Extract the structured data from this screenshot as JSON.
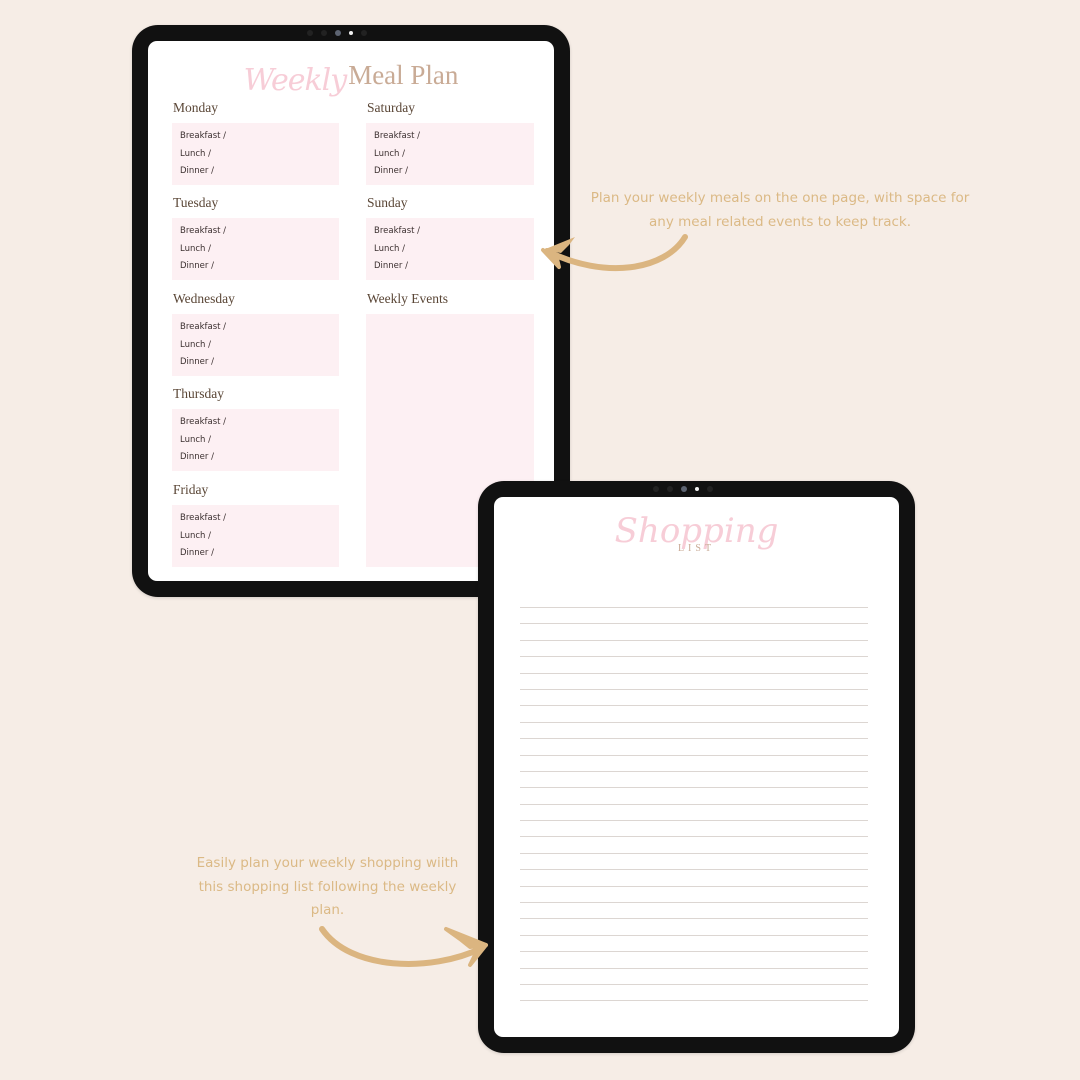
{
  "colors": {
    "background": "#f6ede6",
    "bezel": "#111111",
    "box_fill": "#fdf0f3",
    "title_script": "#f7cdd7",
    "title_serif": "#c9ab96",
    "day_label": "#5a4636",
    "caption": "#dbb985",
    "arrow": "#dbb580",
    "rule_line": "#dcd6d2"
  },
  "meal_plan": {
    "title_script": "Weekly",
    "title_serif": "Meal Plan",
    "meal_labels": [
      "Breakfast /",
      "Lunch /",
      "Dinner /"
    ],
    "left_days": [
      "Monday",
      "Tuesday",
      "Wednesday",
      "Thursday",
      "Friday"
    ],
    "right_days": [
      "Saturday",
      "Sunday"
    ],
    "events_label": "Weekly Events"
  },
  "shopping_list": {
    "title_script": "Shopping",
    "title_sub": "LIST",
    "line_count": 25
  },
  "captions": {
    "meal_plan": "Plan your weekly meals on the one page, with space for any meal related events to keep track.",
    "shopping": "Easily plan your weekly shopping wiith this  shopping list following the weekly plan."
  },
  "icons": {
    "arrow_to_meal_plan": "curved-arrow-left-icon",
    "arrow_to_shopping": "curved-arrow-right-icon",
    "camera": "camera-icon"
  }
}
